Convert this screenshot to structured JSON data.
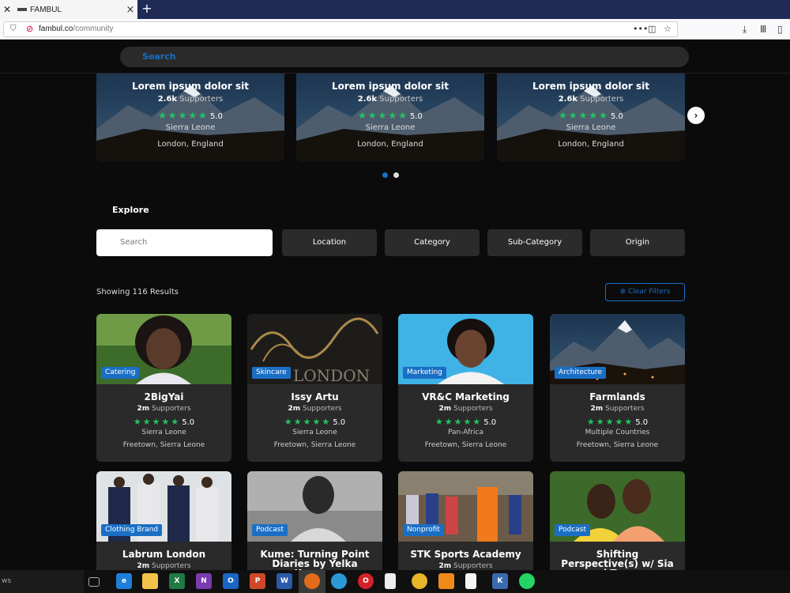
{
  "browser": {
    "tab_title": "FAMBUL",
    "tab_close": "×",
    "new_tab": "+",
    "url_domain": "fambul.co",
    "url_path": "/community",
    "icons": [
      "shield-icon",
      "lock-icon",
      "more-icon",
      "pocket-icon",
      "star-icon",
      "download-icon",
      "library-icon",
      "sidebar-icon"
    ]
  },
  "header": {
    "search_placeholder": "Search"
  },
  "featured": [
    {
      "title": "Lorem ipsum dolor sit",
      "supporters_count": "2.6k",
      "supporters_label": "Supporters",
      "rating": "5.0",
      "country": "Sierra Leone",
      "city": "London, England"
    },
    {
      "title": "Lorem ipsum dolor sit",
      "supporters_count": "2.6k",
      "supporters_label": "Supporters",
      "rating": "5.0",
      "country": "Sierra Leone",
      "city": "London, England"
    },
    {
      "title": "Lorem ipsum dolor sit",
      "supporters_count": "2.6k",
      "supporters_label": "Supporters",
      "rating": "5.0",
      "country": "Sierra Leone",
      "city": "London, England"
    }
  ],
  "carousel": {
    "next_symbol": "›",
    "active_dot": 0,
    "dot_count": 2
  },
  "explore": {
    "title": "Explore",
    "search_placeholder": "Search",
    "filters": [
      "Location",
      "Category",
      "Sub-Category",
      "Origin"
    ]
  },
  "results": {
    "text": "Showing 116 Results",
    "clear_label": "⊗ Clear Filters"
  },
  "stars": "★★★★★",
  "cards": [
    {
      "category": "Catering",
      "name": "2BigYai",
      "supporters_count": "2m",
      "supporters_label": "Supporters",
      "rating": "5.0",
      "country": "Sierra Leone",
      "city": "Freetown, Sierra Leone"
    },
    {
      "category": "Skincare",
      "name": "Issy Artu",
      "supporters_count": "2m",
      "supporters_label": "Supporters",
      "rating": "5.0",
      "country": "Sierra Leone",
      "city": "Freetown, Sierra Leone",
      "image_text": "LONDON"
    },
    {
      "category": "Marketing",
      "name": "VR&C Marketing",
      "supporters_count": "2m",
      "supporters_label": "Supporters",
      "rating": "5.0",
      "country": "Pan-Africa",
      "city": "Freetown, Sierra Leone"
    },
    {
      "category": "Architecture",
      "name": "Farmlands",
      "supporters_count": "2m",
      "supporters_label": "Supporters",
      "rating": "5.0",
      "country": "Multiple Countries",
      "city": "Freetown, Sierra Leone"
    },
    {
      "category": "Clothing Brand",
      "name": "Labrum London",
      "supporters_count": "2m",
      "supporters_label": "Supporters"
    },
    {
      "category": "Podcast",
      "name": "Kume: Turning Point Diaries by Yelka Kamara"
    },
    {
      "category": "Nonprofit",
      "name": "STK Sports Academy",
      "supporters_count": "2m",
      "supporters_label": "Supporters"
    },
    {
      "category": "Podcast",
      "name": "Shifting Perspective(s) w/ Sia and Tommy"
    }
  ],
  "taskbar": {
    "left_text": "ws",
    "apps": [
      "task-view-icon",
      "edge-icon",
      "file-explorer-icon",
      "excel-icon",
      "onenote-icon",
      "outlook-icon",
      "powerpoint-icon",
      "word-icon",
      "firefox-icon",
      "edge-new-icon",
      "opera-icon",
      "notepad-icon",
      "chrome-icon",
      "vlc-icon",
      "document-icon",
      "krita-icon",
      "whatsapp-icon"
    ]
  }
}
